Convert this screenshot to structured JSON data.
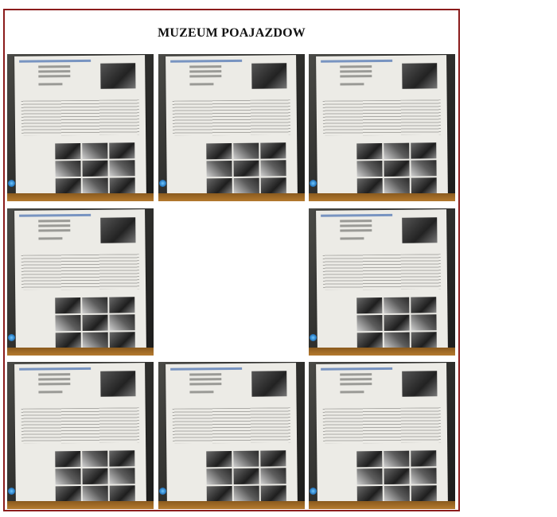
{
  "page": {
    "title": "MUZEUM POAJAZDOW"
  },
  "gallery": {
    "tiles": [
      {
        "present": true
      },
      {
        "present": true
      },
      {
        "present": true
      },
      {
        "present": true
      },
      {
        "present": false
      },
      {
        "present": true
      },
      {
        "present": true
      },
      {
        "present": true
      },
      {
        "present": true
      }
    ]
  },
  "colors": {
    "frame_border": "#8b1c1c",
    "background": "#ffffff"
  }
}
